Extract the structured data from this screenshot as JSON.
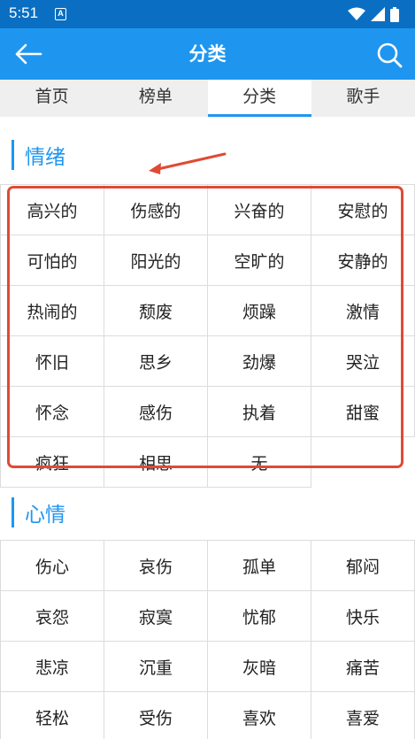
{
  "status_bar": {
    "time": "5:51",
    "notification_icon": "A",
    "icons": [
      "wifi-icon",
      "signal-icon",
      "battery-icon"
    ],
    "color": "#0a6fc2"
  },
  "app_bar": {
    "title": "分类",
    "back_icon": "arrow-left-icon",
    "search_icon": "search-icon",
    "color": "#1e96f0"
  },
  "tabs": [
    {
      "label": "首页",
      "active": false
    },
    {
      "label": "榜单",
      "active": false
    },
    {
      "label": "分类",
      "active": true
    },
    {
      "label": "歌手",
      "active": false
    }
  ],
  "sections": [
    {
      "title": "情绪",
      "items": [
        "高兴的",
        "伤感的",
        "兴奋的",
        "安慰的",
        "可怕的",
        "阳光的",
        "空旷的",
        "安静的",
        "热闹的",
        "颓废",
        "烦躁",
        "激情",
        "怀旧",
        "思乡",
        "劲爆",
        "哭泣",
        "怀念",
        "感伤",
        "执着",
        "甜蜜",
        "疯狂",
        "相思",
        "无"
      ]
    },
    {
      "title": "心情",
      "items": [
        "伤心",
        "哀伤",
        "孤单",
        "郁闷",
        "哀怨",
        "寂寞",
        "忧郁",
        "快乐",
        "悲凉",
        "沉重",
        "灰暗",
        "痛苦",
        "轻松",
        "受伤",
        "喜欢",
        "喜爱"
      ]
    }
  ],
  "annotation": {
    "color": "#e04a34"
  }
}
